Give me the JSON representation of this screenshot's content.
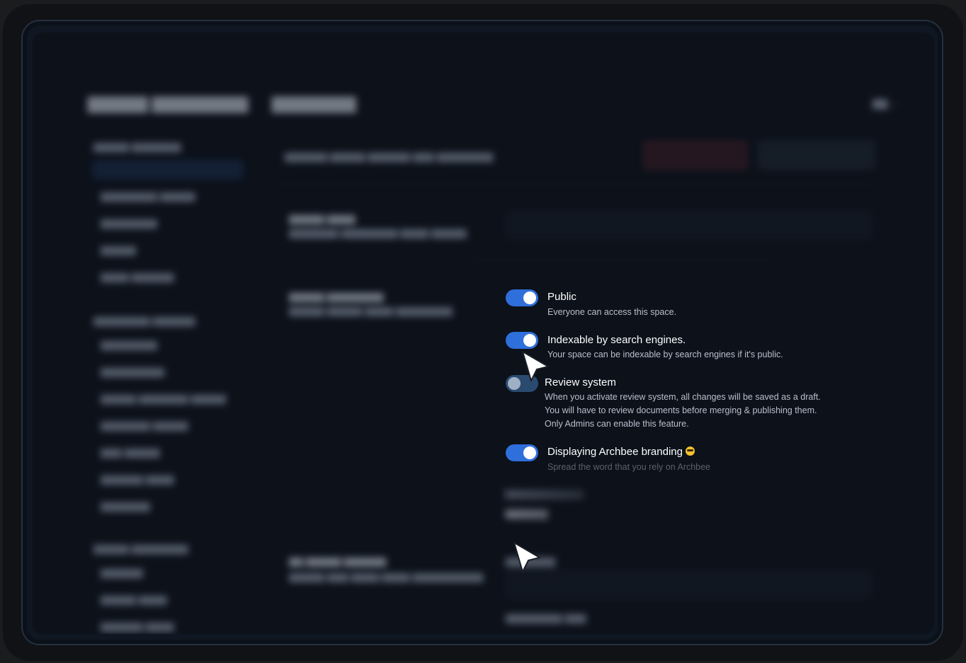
{
  "options": [
    {
      "label": "Public",
      "description": [
        "Everyone can access this space."
      ],
      "enabled": true
    },
    {
      "label": "Indexable by search engines.",
      "description": [
        "Your space can be indexable by search engines if it's public."
      ],
      "enabled": true
    },
    {
      "label": "Review system",
      "description": [
        "When you activate review system, all changes will be saved as a draft.",
        "You will have to review documents before merging & publishing them.",
        "Only Admins can enable this feature."
      ],
      "enabled": false
    },
    {
      "label": "Displaying Archbee branding",
      "description": [
        "Spread the word that you rely on Archbee"
      ],
      "enabled": true
    }
  ],
  "colors": {
    "toggle_on": "#2f6fdc",
    "toggle_off": "#2b4a70",
    "background": "#0c111a"
  },
  "icons": [
    "cursor-arrow-icon",
    "grinning-emoji-icon",
    "chevron-left-icon",
    "chevron-down-icon"
  ]
}
